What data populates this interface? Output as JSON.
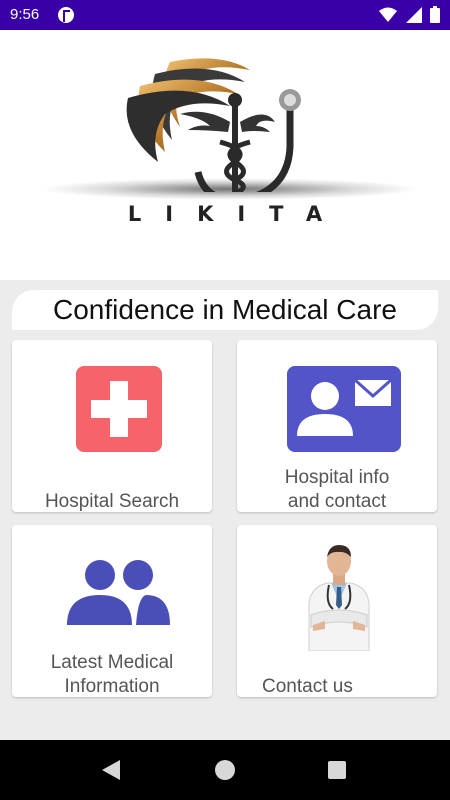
{
  "status_bar": {
    "time": "9:56"
  },
  "logo": {
    "wordmark": "LIKITA"
  },
  "banner": {
    "text": "Confidence in Medical Care"
  },
  "tiles": [
    {
      "label_lines": [
        "Hospital Search"
      ],
      "icon": "hospital-cross-icon",
      "color": "#f5636b"
    },
    {
      "label_lines": [
        "Hospital info",
        "and contact"
      ],
      "icon": "contact-card-icon",
      "color": "#5254c8"
    },
    {
      "label_lines": [
        "Latest Medical",
        "Information"
      ],
      "icon": "people-group-icon",
      "color": "#4a4fb7"
    },
    {
      "label_lines": [
        "Contact us"
      ],
      "icon": "doctor-image"
    }
  ],
  "colors": {
    "status_bar": "#3a00a8",
    "background": "#ececec"
  }
}
